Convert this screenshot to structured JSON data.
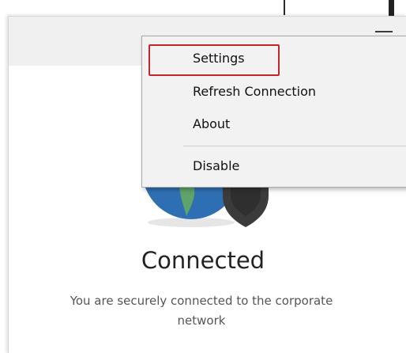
{
  "menu": {
    "items": [
      {
        "label": "Settings"
      },
      {
        "label": "Refresh Connection"
      },
      {
        "label": "About"
      },
      {
        "label": "Disable"
      }
    ]
  },
  "status": {
    "title": "Connected",
    "description": "You are securely connected to the corporate network"
  },
  "colors": {
    "highlight": "#c1272d",
    "globe_ocean": "#2e6fb3",
    "globe_land": "#5ea36a",
    "shield": "#3b3b3b"
  },
  "icons": [
    "hamburger-menu-icon",
    "globe-icon",
    "shield-icon"
  ]
}
